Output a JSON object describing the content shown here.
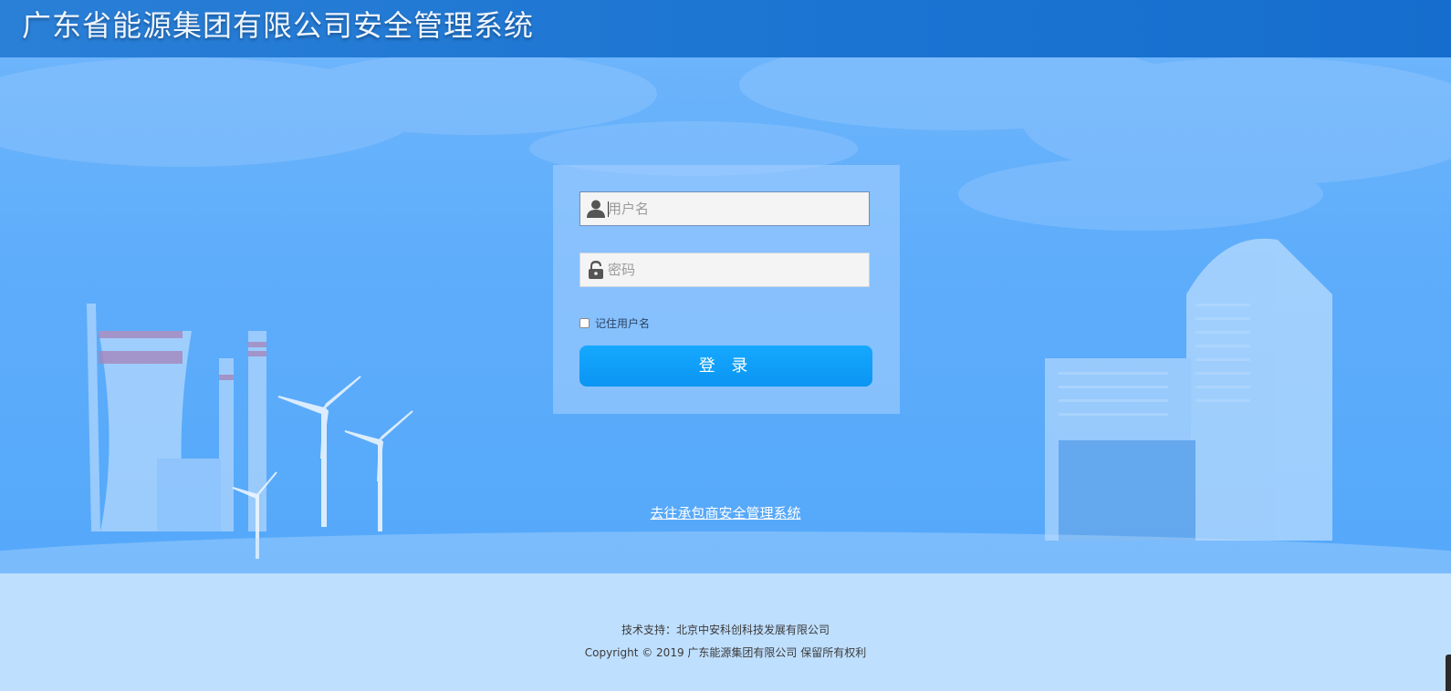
{
  "header": {
    "title": "广东省能源集团有限公司安全管理系统"
  },
  "login": {
    "username_placeholder": "用户名",
    "username_value": "",
    "password_placeholder": "密码",
    "password_value": "",
    "remember_label": "记住用户名",
    "remember_checked": false,
    "submit_label": "登 录",
    "user_icon": "user-icon",
    "lock_icon": "lock-icon"
  },
  "links": {
    "contractor_system": "去往承包商安全管理系统"
  },
  "footer": {
    "support": "技术支持：北京中安科创科技发展有限公司",
    "copyright": "Copyright © 2019 广东能源集团有限公司 保留所有权利"
  },
  "colors": {
    "header": "#1b74d2",
    "hero": "#5eadfb",
    "footer": "#bfdfff",
    "button": "#0f9ff8"
  }
}
